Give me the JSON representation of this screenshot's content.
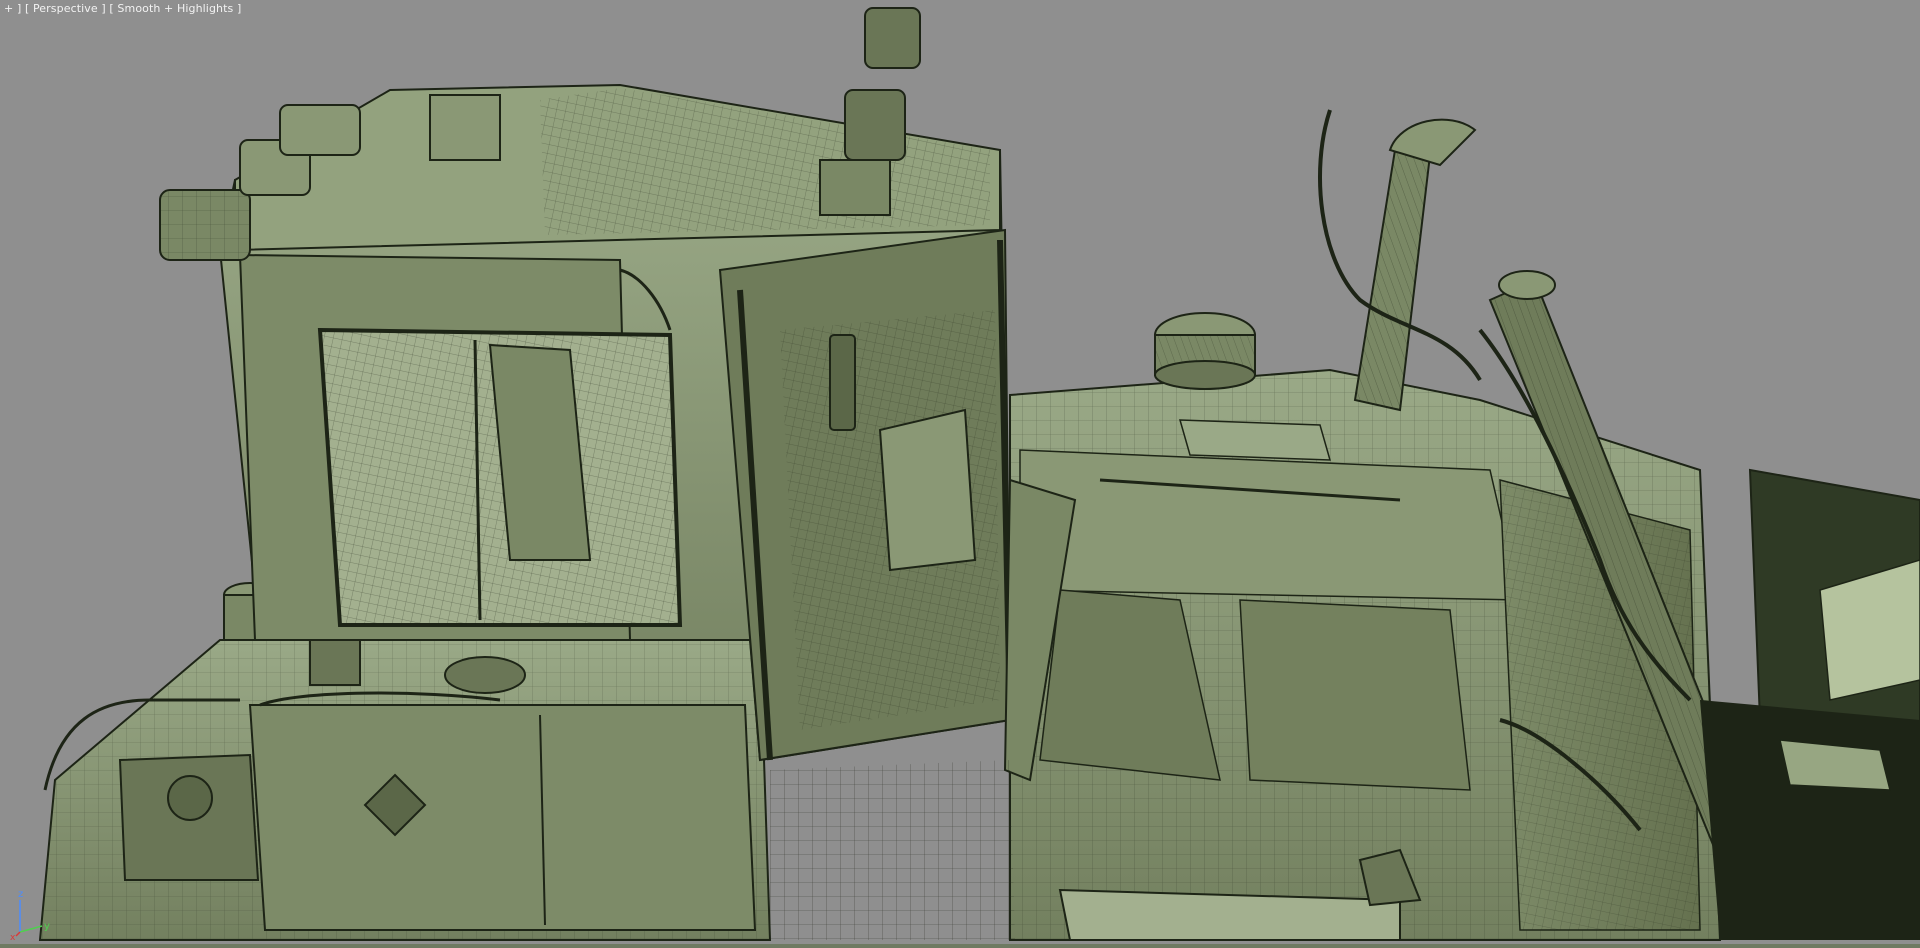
{
  "viewport": {
    "label_parts": [
      "+",
      "]",
      "[",
      "Perspective",
      "]",
      "[",
      "Smooth + Highlights",
      "]"
    ],
    "label_text": "+ ] [ Perspective ] [ Smooth + Highlights ]",
    "menu_plus": "+",
    "view_name": "Perspective",
    "shading_mode": "Smooth + Highlights"
  },
  "gizmo": {
    "z": "z",
    "y": "y",
    "x": "x",
    "colors": {
      "x": "#d93a3a",
      "y": "#4fd04f",
      "z": "#4a8cff"
    }
  },
  "colors": {
    "background": "#8f8f8f",
    "mesh_fill": "#7f8d6b",
    "mesh_light": "#97a682",
    "mesh_dark": "#4f5b40",
    "wire": "#1d2416"
  }
}
